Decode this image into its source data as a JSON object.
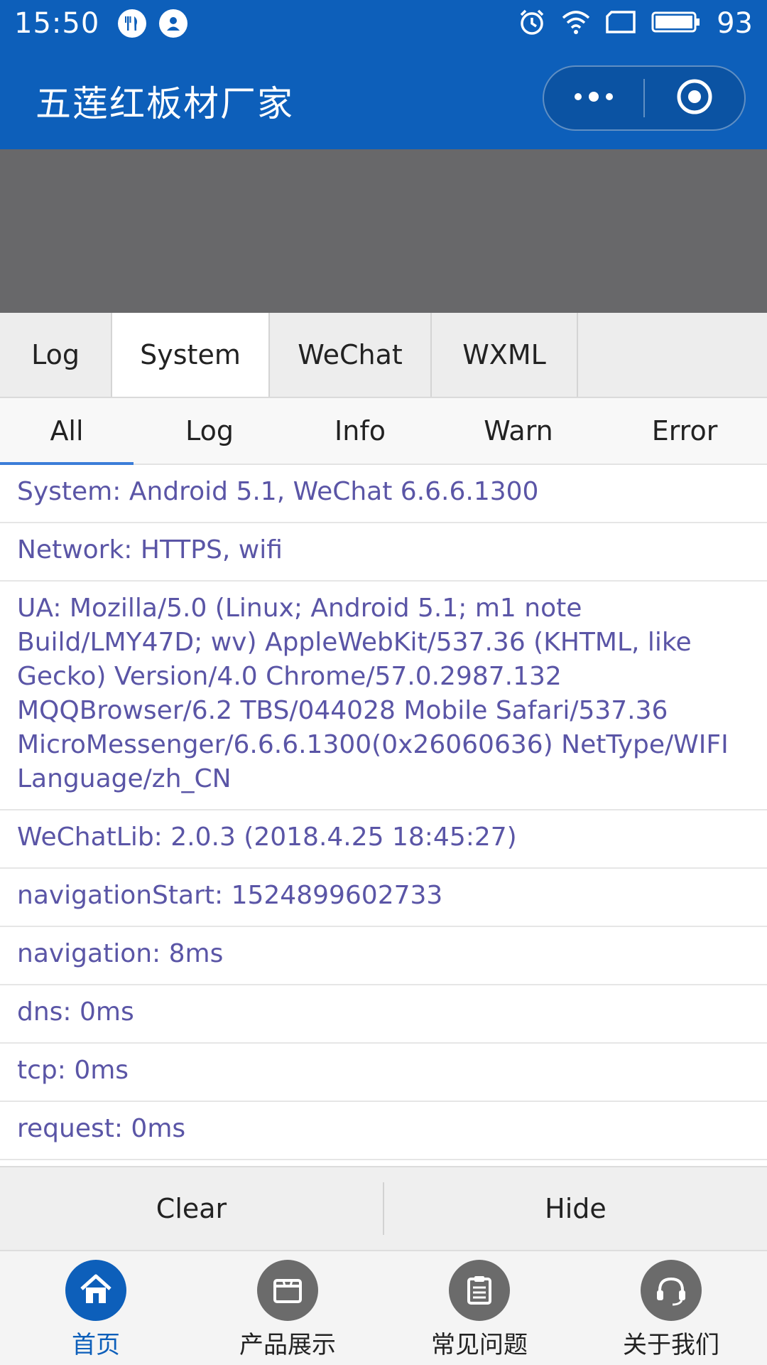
{
  "status_bar": {
    "time": "15:50",
    "battery_level": "93",
    "icons": [
      "fork-knife-icon",
      "user-icon",
      "alarm-icon",
      "wifi-icon",
      "sim-icon",
      "battery-icon"
    ]
  },
  "nav_bar": {
    "title": "五莲红板材厂家",
    "capsule": [
      "more-dots-icon",
      "close-target-icon"
    ]
  },
  "console_tabs": [
    {
      "label": "Log",
      "active": false
    },
    {
      "label": "System",
      "active": true
    },
    {
      "label": "WeChat",
      "active": false
    },
    {
      "label": "WXML",
      "active": false
    }
  ],
  "sub_tabs": [
    {
      "label": "All",
      "active": true
    },
    {
      "label": "Log",
      "active": false
    },
    {
      "label": "Info",
      "active": false
    },
    {
      "label": "Warn",
      "active": false
    },
    {
      "label": "Error",
      "active": false
    }
  ],
  "log_rows": [
    "System: Android 5.1, WeChat 6.6.6.1300",
    "Network: HTTPS, wifi",
    "UA: Mozilla/5.0 (Linux; Android 5.1; m1 note Build/LMY47D; wv) AppleWebKit/537.36 (KHTML, like Gecko) Version/4.0 Chrome/57.0.2987.132 MQQBrowser/6.2 TBS/044028 Mobile Safari/537.36 MicroMessenger/6.6.6.1300(0x26060636) NetType/WIFI Language/zh_CN",
    "WeChatLib: 2.0.3 (2018.4.25 18:45:27)",
    "navigationStart: 1524899602733",
    "navigation: 8ms",
    "dns: 0ms",
    "tcp: 0ms",
    "request: 0ms"
  ],
  "console_bottom": {
    "clear_label": "Clear",
    "hide_label": "Hide"
  },
  "tab_bar": [
    {
      "label": "首页",
      "icon": "home-icon",
      "active": true
    },
    {
      "label": "产品展示",
      "icon": "box-icon",
      "active": false
    },
    {
      "label": "常见问题",
      "icon": "clipboard-icon",
      "active": false
    },
    {
      "label": "关于我们",
      "icon": "headset-icon",
      "active": false
    }
  ],
  "colors": {
    "brand_blue": "#0d5fba",
    "log_text": "#5a55a6",
    "active_underline": "#3b7dd8"
  }
}
